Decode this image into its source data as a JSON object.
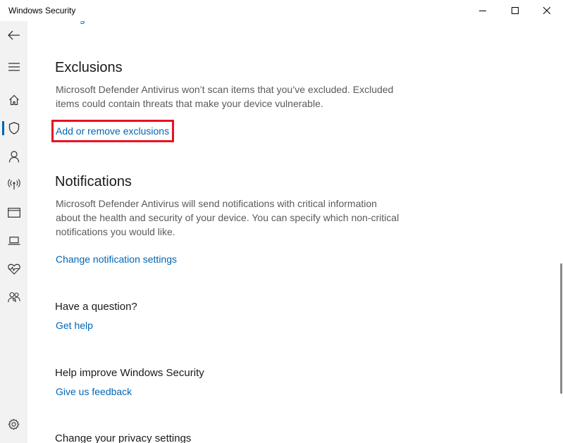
{
  "window": {
    "title": "Windows Security"
  },
  "nav": {
    "items": [
      {
        "id": "back",
        "icon": "back-arrow-icon"
      },
      {
        "id": "menu",
        "icon": "hamburger-menu-icon"
      },
      {
        "id": "home",
        "icon": "home-icon"
      },
      {
        "id": "virus-protection",
        "icon": "shield-icon",
        "active": true
      },
      {
        "id": "account-protection",
        "icon": "person-icon"
      },
      {
        "id": "firewall",
        "icon": "antenna-icon"
      },
      {
        "id": "app-browser-control",
        "icon": "browser-window-icon"
      },
      {
        "id": "device-security",
        "icon": "laptop-icon"
      },
      {
        "id": "device-performance",
        "icon": "heart-pulse-icon"
      },
      {
        "id": "family-options",
        "icon": "family-icon"
      },
      {
        "id": "settings",
        "icon": "gear-icon"
      }
    ]
  },
  "exclusions": {
    "heading": "Exclusions",
    "description": "Microsoft Defender Antivirus won’t scan items that you’ve excluded. Excluded items could contain threats that make your device vulnerable.",
    "link": "Add or remove exclusions"
  },
  "notifications": {
    "heading": "Notifications",
    "description": "Microsoft Defender Antivirus will send notifications with critical information about the health and security of your device. You can specify which non-critical notifications you would like.",
    "link": "Change notification settings"
  },
  "question": {
    "heading": "Have a question?",
    "link": "Get help"
  },
  "improve": {
    "heading": "Help improve Windows Security",
    "link": "Give us feedback"
  },
  "privacy": {
    "heading": "Change your privacy settings"
  },
  "colors": {
    "accent": "#0063b1",
    "link": "#0066b4",
    "highlight": "#e81123",
    "rail": "#f2f2f2"
  }
}
